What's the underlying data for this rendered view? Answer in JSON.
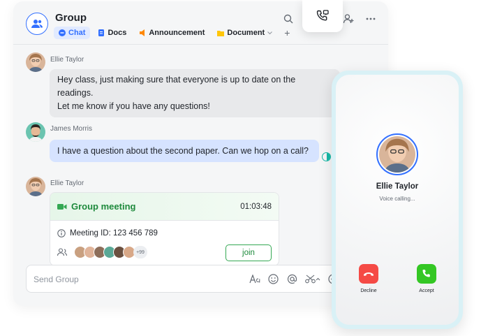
{
  "header": {
    "title": "Group",
    "tabs": [
      {
        "label": "Chat",
        "icon": "chat-bubble-icon",
        "active": true,
        "color": "#3370ff"
      },
      {
        "label": "Docs",
        "icon": "docs-icon",
        "color": "#3370ff"
      },
      {
        "label": "Announcement",
        "icon": "megaphone-icon",
        "color": "#ff8800"
      },
      {
        "label": "Document",
        "icon": "folder-icon",
        "color": "#ffc60a"
      }
    ],
    "add_tab": "+"
  },
  "messages": [
    {
      "sender": "Ellie Taylor",
      "text_line1": "Hey class, just making sure that everyone is up to date on the readings.",
      "text_line2": "Let me know if you have any questions!"
    },
    {
      "sender": "James Morris",
      "text": "I have a question about the second paper. Can we hop on a call?"
    },
    {
      "sender": "Ellie Taylor"
    }
  ],
  "meeting": {
    "title": "Group meeting",
    "duration": "01:03:48",
    "meeting_id": "Meeting ID: 123 456 789",
    "more_count": "+99",
    "join_label": "join"
  },
  "composer": {
    "placeholder": "Send Group"
  },
  "call": {
    "caller_name": "Ellie Taylor",
    "status": "Voice calling...",
    "decline_label": "Decline",
    "accept_label": "Accept"
  },
  "colors": {
    "accent": "#3370ff",
    "meeting_green": "#1e8a3c",
    "decline_red": "#f54a45",
    "accept_green": "#34c724"
  }
}
